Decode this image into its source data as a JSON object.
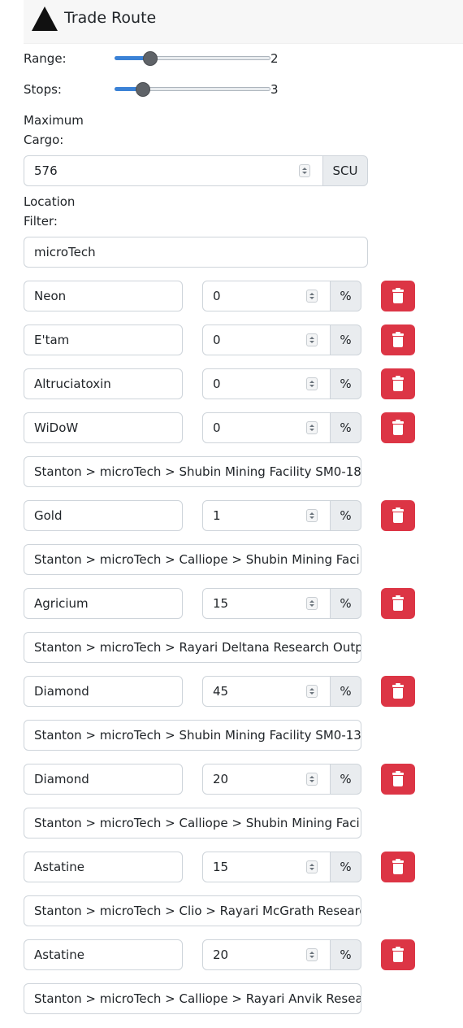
{
  "header": {
    "title": "Trade Route"
  },
  "range": {
    "label": "Range:",
    "value": "2",
    "fraction": 0.2
  },
  "stops": {
    "label": "Stops:",
    "value": "3",
    "fraction": 0.15
  },
  "max_cargo": {
    "label_line1": "Maximum",
    "label_line2": "Cargo:",
    "value": "576",
    "unit": "SCU"
  },
  "location_filter": {
    "label_line1": "Location",
    "label_line2": "Filter:",
    "value": "microTech"
  },
  "rows": [
    {
      "commodity": "Neon",
      "percent": "0",
      "unit": "%"
    },
    {
      "commodity": "E'tam",
      "percent": "0",
      "unit": "%"
    },
    {
      "commodity": "Altruciatoxin",
      "percent": "0",
      "unit": "%"
    },
    {
      "commodity": "WiDoW",
      "percent": "0",
      "unit": "%",
      "location": "Stanton > microTech > Shubin Mining Facility SM0-18"
    },
    {
      "commodity": "Gold",
      "percent": "1",
      "unit": "%",
      "location": "Stanton > microTech > Calliope > Shubin Mining Facility"
    },
    {
      "commodity": "Agricium",
      "percent": "15",
      "unit": "%",
      "location": "Stanton > microTech > Rayari Deltana Research Outpost"
    },
    {
      "commodity": "Diamond",
      "percent": "45",
      "unit": "%",
      "location": "Stanton > microTech > Shubin Mining Facility SM0-13"
    },
    {
      "commodity": "Diamond",
      "percent": "20",
      "unit": "%",
      "location": "Stanton > microTech > Calliope > Shubin Mining Facility"
    },
    {
      "commodity": "Astatine",
      "percent": "15",
      "unit": "%",
      "location": "Stanton > microTech > Clio > Rayari McGrath Research Outpost"
    },
    {
      "commodity": "Astatine",
      "percent": "20",
      "unit": "%",
      "location": "Stanton > microTech > Calliope > Rayari Anvik Research Outpost"
    }
  ],
  "icons": {
    "header": "triangle-icon",
    "delete": "trash-icon",
    "stepper": "spinner-arrows-icon"
  },
  "colors": {
    "danger": "#dc3545",
    "slider": "#3b82d6",
    "header_bg": "#f7f7f7"
  }
}
